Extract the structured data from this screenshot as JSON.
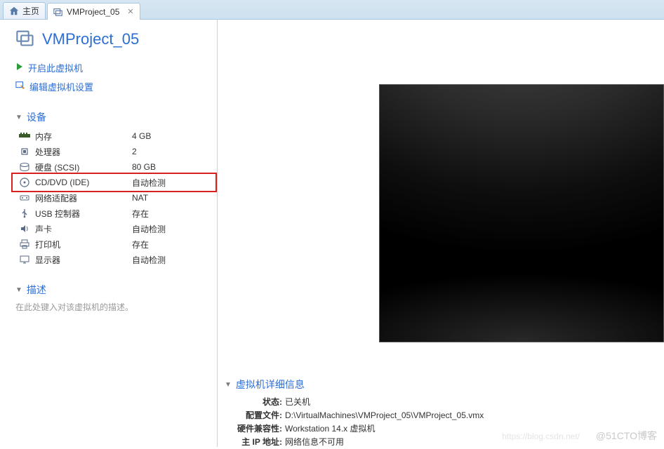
{
  "tabs": {
    "home": "主页",
    "project": "VMProject_05"
  },
  "vm_title": "VMProject_05",
  "actions": {
    "power_on": "开启此虚拟机",
    "edit_settings": "编辑虚拟机设置"
  },
  "sections": {
    "devices": "设备",
    "description": "描述"
  },
  "devices": [
    {
      "label": "内存",
      "value": "4 GB"
    },
    {
      "label": "处理器",
      "value": "2"
    },
    {
      "label": "硬盘 (SCSI)",
      "value": "80 GB"
    },
    {
      "label": "CD/DVD (IDE)",
      "value": "自动检测"
    },
    {
      "label": "网络适配器",
      "value": "NAT"
    },
    {
      "label": "USB 控制器",
      "value": "存在"
    },
    {
      "label": "声卡",
      "value": "自动检测"
    },
    {
      "label": "打印机",
      "value": "存在"
    },
    {
      "label": "显示器",
      "value": "自动检测"
    }
  ],
  "description_placeholder": "在此处键入对该虚拟机的描述。",
  "details": {
    "title": "虚拟机详细信息",
    "rows": [
      {
        "key": "状态:",
        "value": "已关机"
      },
      {
        "key": "配置文件:",
        "value": "D:\\VirtualMachines\\VMProject_05\\VMProject_05.vmx"
      },
      {
        "key": "硬件兼容性:",
        "value": "Workstation 14.x 虚拟机"
      },
      {
        "key": "主 IP 地址:",
        "value": "网络信息不可用"
      }
    ]
  },
  "watermark": "@51CTO博客",
  "watermark_sub": "https://blog.csdn.net/"
}
